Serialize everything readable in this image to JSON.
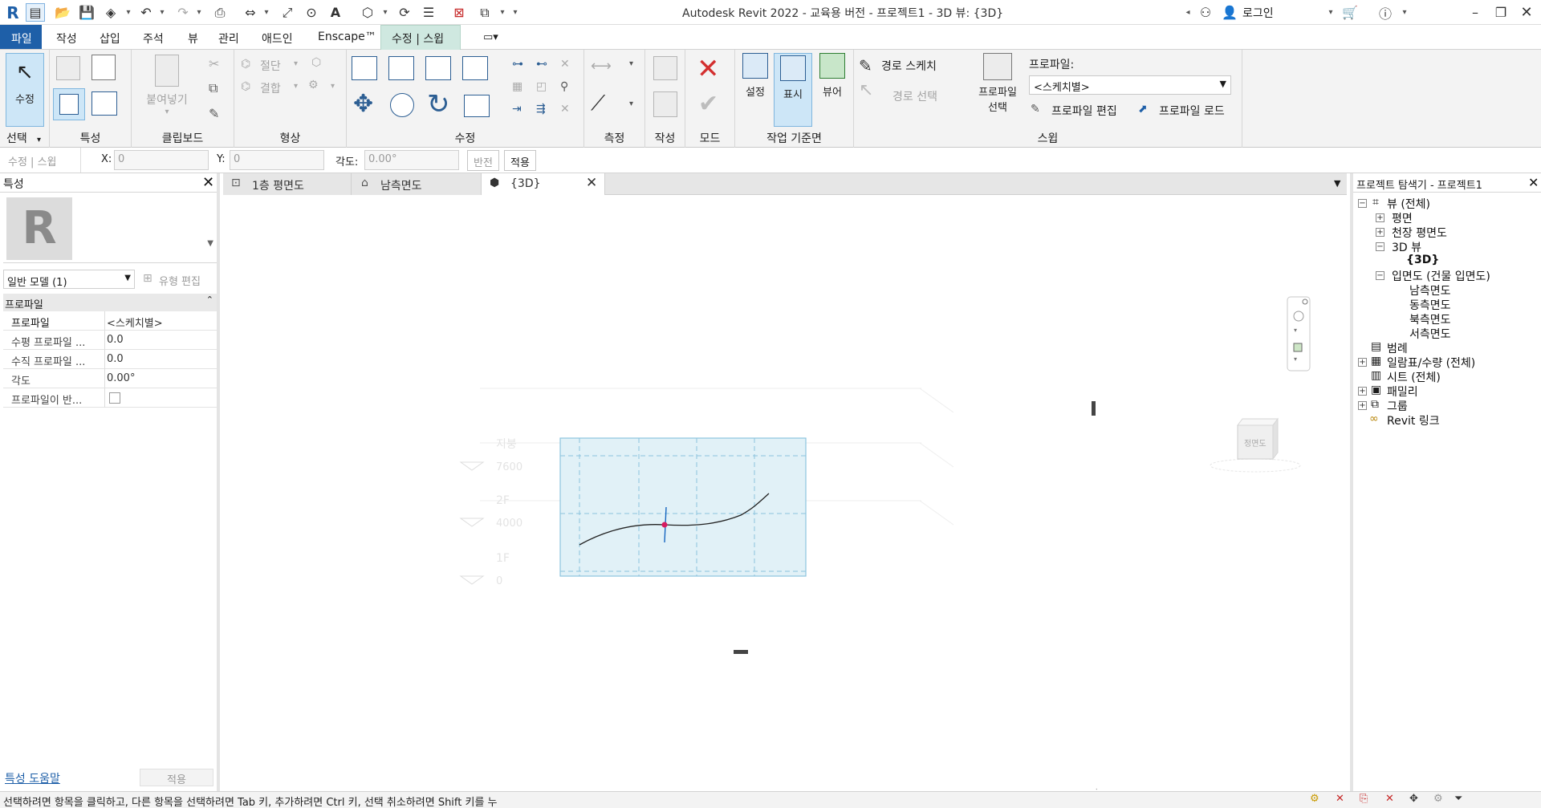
{
  "title_bar": {
    "title": "Autodesk Revit 2022 - 교육용 버전 - 프로젝트1 - 3D 뷰: {3D}",
    "login_label": "로그인",
    "qat_icons": [
      "revit-logo",
      "open-icon",
      "save-icon",
      "sync-icon",
      "undo-icon",
      "redo-icon",
      "print-icon",
      "measure-icon",
      "dimension-icon",
      "tag-icon",
      "text-icon",
      "3d-view-icon",
      "section-icon",
      "thin-lines-icon",
      "close-hidden-icon",
      "switch-windows-icon",
      "customize-icon"
    ]
  },
  "menu": {
    "tabs": [
      "파일",
      "작성",
      "삽입",
      "주석",
      "뷰",
      "관리",
      "애드인",
      "Enscape™",
      "수정 | 스윕"
    ],
    "active_tab": "수정 | 스윕"
  },
  "ribbon": {
    "select_panel": {
      "button": "수정",
      "label": "선택"
    },
    "properties_panel": {
      "label": "특성"
    },
    "clipboard_panel": {
      "paste": "붙여넣기",
      "label": "클립보드"
    },
    "geometry_panel": {
      "cut": "절단",
      "join": "결합",
      "label": "형상"
    },
    "modify_panel": {
      "label": "수정"
    },
    "measure_panel": {
      "label": "측정"
    },
    "create_panel": {
      "label": "작성"
    },
    "mode_panel": {
      "label": "모드"
    },
    "workplane_panel": {
      "set": "설정",
      "show": "표시",
      "viewer": "뷰어",
      "label": "작업 기준면"
    },
    "sweep_panel": {
      "sketch_path": "경로 스케치",
      "pick_path": "경로 선택",
      "profile_select_line1": "프로파일",
      "profile_select_line2": "선택",
      "profile_label": "프로파일:",
      "profile_value": "<스케치별>",
      "edit_profile": "프로파일 편집",
      "load_profile": "프로파일 로드",
      "label": "스윕"
    }
  },
  "options_bar": {
    "context": "수정 | 스윕",
    "x_label": "X:",
    "x_value": "0",
    "y_label": "Y:",
    "y_value": "0",
    "angle_label": "각도:",
    "angle_value": "0.00°",
    "flip": "반전",
    "apply": "적용"
  },
  "properties": {
    "title": "특성",
    "type_selector": "일반 모델 (1)",
    "edit_type": "유형 편집",
    "section": "프로파일",
    "rows": [
      {
        "key": "프로파일",
        "value": "<스케치별>"
      },
      {
        "key": "수평 프로파일 ...",
        "value": "0.0"
      },
      {
        "key": "수직 프로파일 ...",
        "value": "0.0"
      },
      {
        "key": "각도",
        "value": "0.00°"
      },
      {
        "key": "프로파일이 반...",
        "value": ""
      }
    ],
    "help_link": "특성 도움말",
    "apply": "적용"
  },
  "view_tabs": [
    {
      "label": "1층 평면도"
    },
    {
      "label": "남측면도"
    },
    {
      "label": "{3D}"
    }
  ],
  "canvas": {
    "level_names": [
      "지붕",
      "2F",
      "1F"
    ],
    "level_elevations": [
      "7600",
      "4000",
      "0"
    ],
    "viewcube_face": "정면도"
  },
  "project_browser": {
    "title": "프로젝트 탐색기 - 프로젝트1",
    "views_all": "뷰 (전체)",
    "floor_plans": "평면",
    "ceiling_plans": "천장 평면도",
    "views_3d": "3D 뷰",
    "view_3d_item": "{3D}",
    "elevations": "입면도 (건물 입면도)",
    "elevation_items": [
      "남측면도",
      "동측면도",
      "북측면도",
      "서측면도"
    ],
    "legends": "범례",
    "schedules": "일람표/수량 (전체)",
    "sheets": "시트 (전체)",
    "families": "패밀리",
    "groups": "그룹",
    "revit_links": "Revit 링크"
  },
  "status_bar": {
    "message": "선택하려면 항목을 클릭하고, 다른 항목을 선택하려면 Tab 키, 추가하려면 Ctrl 키, 선택 취소하려면 Shift 키를 누"
  },
  "colors": {
    "accent": "#1e5fa8",
    "ribbon_context_tab": "#cfe8e0",
    "selected_button": "#cde6f7",
    "sketch_plane_fill": "#e1f1f7",
    "sketch_plane_edge": "#8cc4de"
  }
}
